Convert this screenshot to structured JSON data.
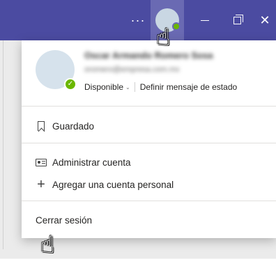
{
  "titlebar": {
    "more_icon": "ellipsis",
    "avatar_icon": "user-avatar",
    "minimize_icon": "minimize",
    "restore_icon": "restore",
    "close_icon": "close",
    "close_glyph": "✕",
    "more_glyph": "···"
  },
  "profile": {
    "name": "Oscar Armando Romero Sosa",
    "email": "oromero@empresa.com.mx",
    "status": "Disponible",
    "set_status": "Definir mensaje de estado"
  },
  "menu": {
    "saved": "Guardado",
    "manage_account": "Administrar cuenta",
    "add_personal_account": "Agregar una cuenta personal",
    "sign_out": "Cerrar sesión"
  },
  "colors": {
    "titlebar": "#4b4ba1",
    "presence": "#6bb700"
  }
}
